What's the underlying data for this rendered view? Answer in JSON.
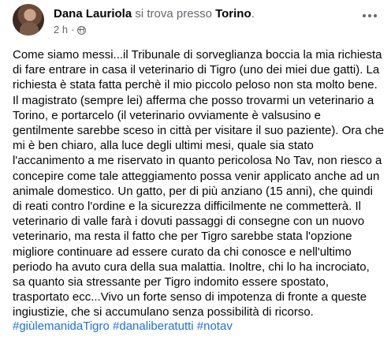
{
  "post": {
    "author": "Dana Lauriola",
    "at_text": "si trova presso",
    "location": "Torino",
    "location_suffix": ".",
    "time": "2 h",
    "separator": "·",
    "lines": [
      "Come siamo messi...il Tribunale di sorveglianza boccia la mia richiesta",
      "di fare entrare in casa il veterinario di Tigro (uno dei miei due gatti). La",
      "richiesta è stata fatta perchè il mio piccolo peloso non sta molto bene.",
      "Il magistrato (sempre lei) afferma che posso trovarmi un veterinario a",
      "Torino, e portarcelo (il veterinario ovviamente è valsusino e",
      "gentilmente sarebbe sceso in città per visitare il suo paziente). Ora che",
      "mi è ben chiaro, alla luce degli ultimi mesi, quale sia stato",
      "l'accanimento a me riservato in quanto pericolosa No Tav, non riesco a",
      "concepire come tale atteggiamento possa venir applicato anche ad un",
      "animale domestico. Un gatto, per di più anziano (15 anni), che quindi",
      "di reati contro l'ordine e la sicurezza difficilmente ne commetterà. Il",
      "veterinario di valle farà i dovuti passaggi di consegne con un nuovo",
      "veterinario, ma resta il fatto che per Tigro sarebbe stata l'opzione",
      "migliore continuare ad essere curato da chi conosce e nell'ultimo",
      "periodo ha avuto cura della sua malattia. Inoltre, chi lo ha incrociato,",
      "sa quanto sia stressante per Tigro indomito essere spostato,",
      "trasportato ecc...Vivo un forte senso di impotenza di fronte a queste",
      "ingiustizie, che si accumulano senza possibilità di ricorso."
    ],
    "hashtags": [
      "#giùlemanidaTigro",
      "#danaliberatutti",
      "#notav"
    ]
  },
  "icons": {
    "privacy": "globe-icon",
    "menu": "more-options-icon"
  },
  "colors": {
    "text": "#050505",
    "secondary": "#65676b",
    "link": "#216fdb"
  }
}
